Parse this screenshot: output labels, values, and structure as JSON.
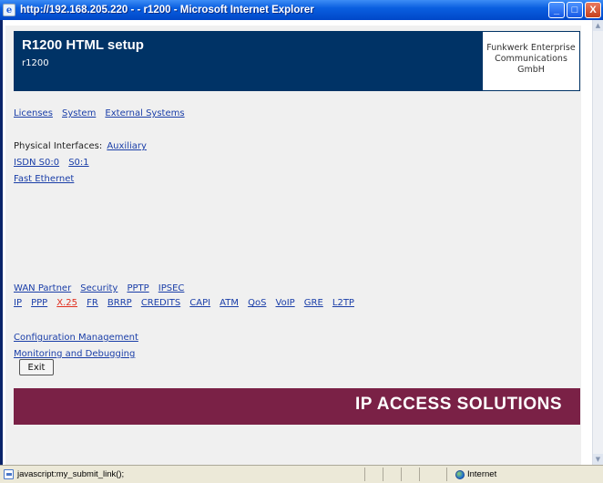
{
  "window": {
    "title": "http://192.168.205.220 - - r1200 - Microsoft Internet Explorer",
    "buttons": {
      "minimize": "_",
      "maximize": "□",
      "close": "X"
    }
  },
  "header": {
    "title": "R1200 HTML setup",
    "subtitle": "r1200",
    "company_line1": "Funkwerk Enterprise",
    "company_line2": "Communications",
    "company_line3": "GmbH"
  },
  "nav_top": [
    "Licenses",
    "System",
    "External Systems"
  ],
  "physical": {
    "label": "Physical Interfaces:",
    "auxiliary": "Auxiliary",
    "isdn": [
      "ISDN S0:0",
      "S0:1"
    ],
    "ethernet": "Fast Ethernet"
  },
  "wan_row": [
    "WAN Partner",
    "Security",
    "PPTP",
    "IPSEC"
  ],
  "protocol_row": [
    "IP",
    "PPP",
    "X.25",
    "FR",
    "BRRP",
    "CREDITS",
    "CAPI",
    "ATM",
    "QoS",
    "VoIP",
    "GRE",
    "L2TP"
  ],
  "protocol_active": "X.25",
  "bottom_links": [
    "Configuration Management",
    "Monitoring and Debugging"
  ],
  "exit_label": "Exit",
  "banner": "IP ACCESS SOLUTIONS",
  "status": {
    "text": "javascript:my_submit_link();",
    "zone": "Internet"
  },
  "colors": {
    "header_bg": "#003366",
    "banner_bg": "#7a2146",
    "link": "#1a3ea8",
    "active_link": "#e03020"
  }
}
